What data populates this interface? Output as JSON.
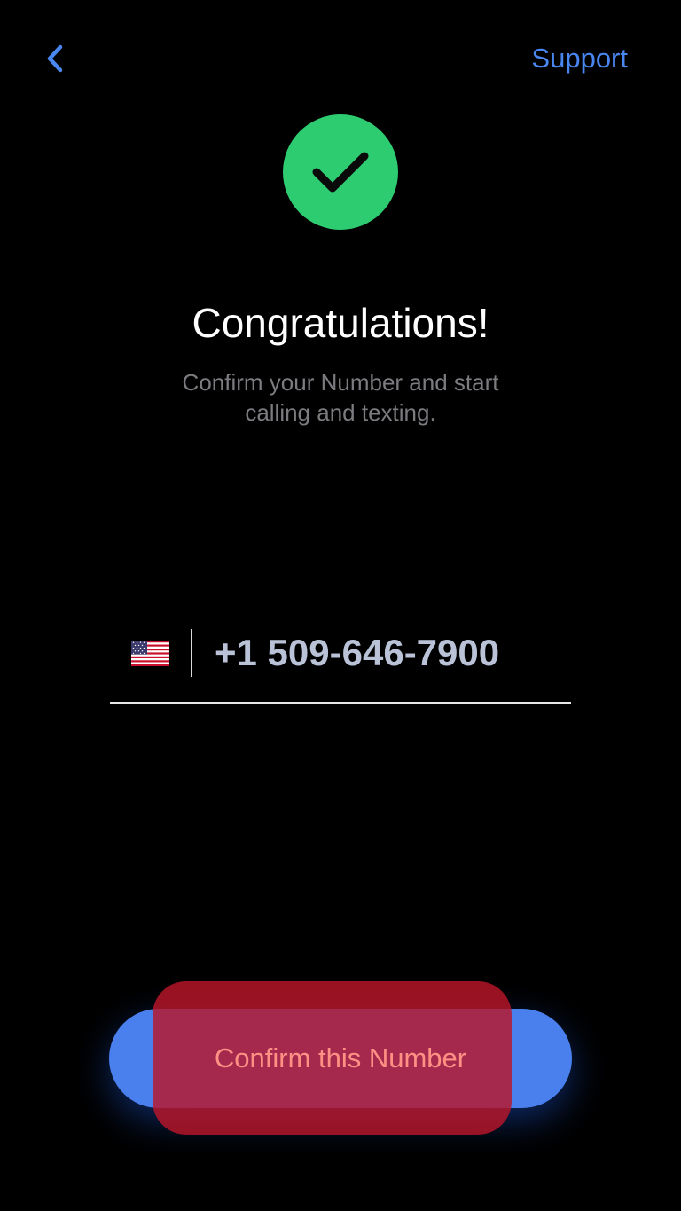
{
  "nav": {
    "back_icon": "chevron-left-icon",
    "support_label": "Support"
  },
  "header": {
    "status_icon": "checkmark-icon",
    "title": "Congratulations!",
    "subtitle": "Confirm your Number and start calling and texting."
  },
  "phone": {
    "country_flag_icon": "us-flag-icon",
    "number": "+1 509-646-7900"
  },
  "actions": {
    "confirm_label": "Confirm this Number"
  },
  "colors": {
    "accent": "#4A86F0",
    "success": "#2ECC71",
    "background": "#000000"
  }
}
